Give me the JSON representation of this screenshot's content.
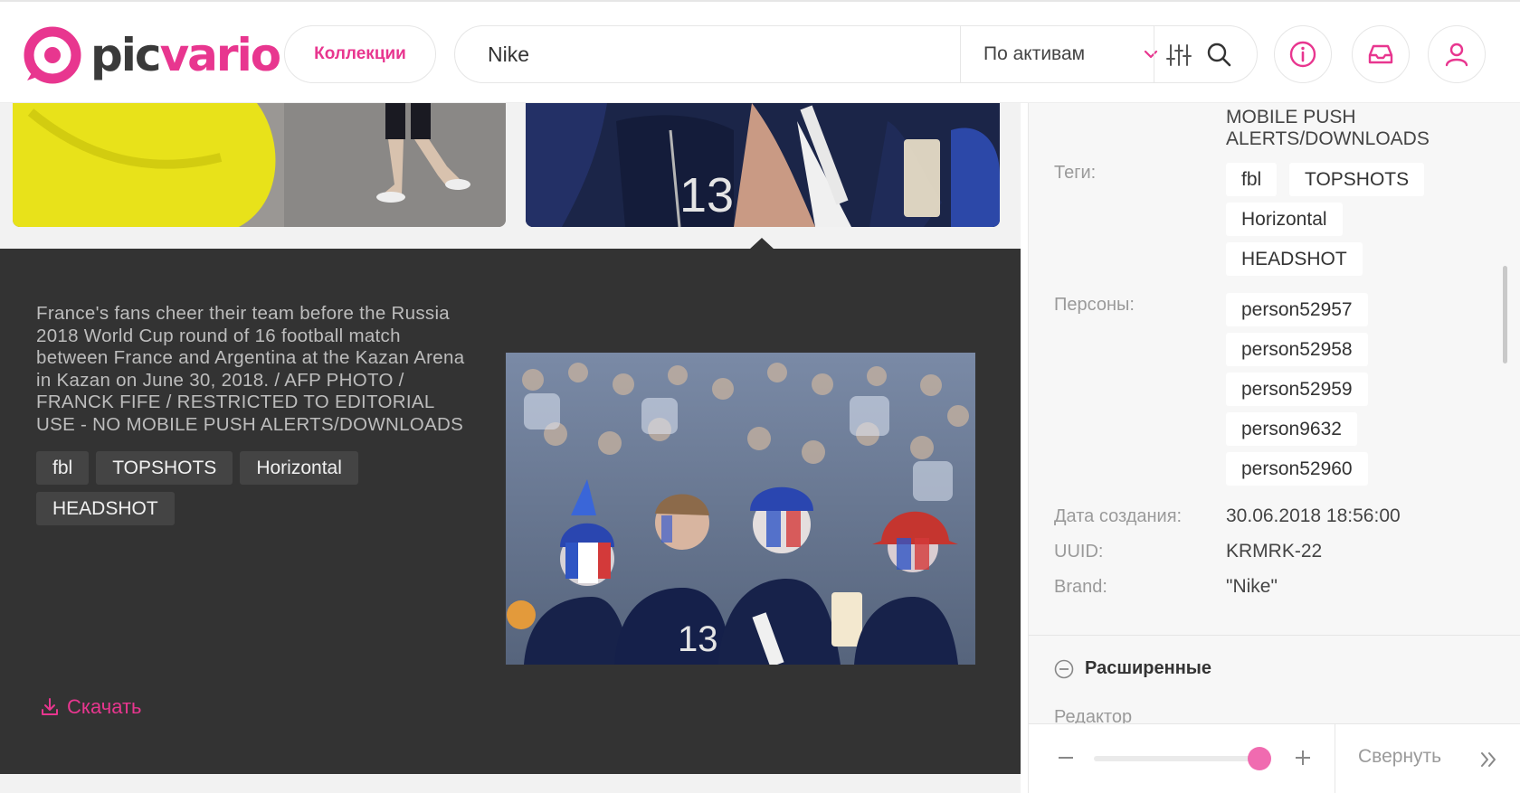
{
  "header": {
    "logo_text_1": "pic",
    "logo_text_2": "vario",
    "collections_label": "Коллекции",
    "search_value": "Nike",
    "scope_label": "По активам",
    "icons": [
      "filter-icon",
      "search-icon",
      "info-icon",
      "inbox-icon",
      "user-icon"
    ]
  },
  "detail": {
    "caption": "France's fans cheer their team before the Russia 2018 World Cup round of 16 football match between France and Argentina at the Kazan Arena in Kazan on June 30, 2018. / AFP PHOTO / FRANCK FIFE / RESTRICTED TO EDITORIAL USE - NO MOBILE PUSH ALERTS/DOWNLOADS",
    "tags": [
      "fbl",
      "TOPSHOTS",
      "Horizontal",
      "HEADSHOT"
    ],
    "download_label": "Скачать"
  },
  "panel": {
    "description_tail": "MOBILE PUSH ALERTS/DOWNLOADS",
    "tags_label": "Теги:",
    "tags": [
      "fbl",
      "TOPSHOTS",
      "Horizontal",
      "HEADSHOT"
    ],
    "persons_label": "Персоны:",
    "persons": [
      "person52957",
      "person52958",
      "person52959",
      "person9632",
      "person52960"
    ],
    "created_label": "Дата создания:",
    "created_value": "30.06.2018 18:56:00",
    "uuid_label": "UUID:",
    "uuid_value": "KRMRK-22",
    "brand_label": "Brand:",
    "brand_value": "\"Nike\"",
    "advanced_label": "Расширенные",
    "editor_label": "Редактор",
    "collapse_label": "Свернуть"
  },
  "colors": {
    "accent": "#e8368f",
    "dark_panel": "#333333"
  }
}
